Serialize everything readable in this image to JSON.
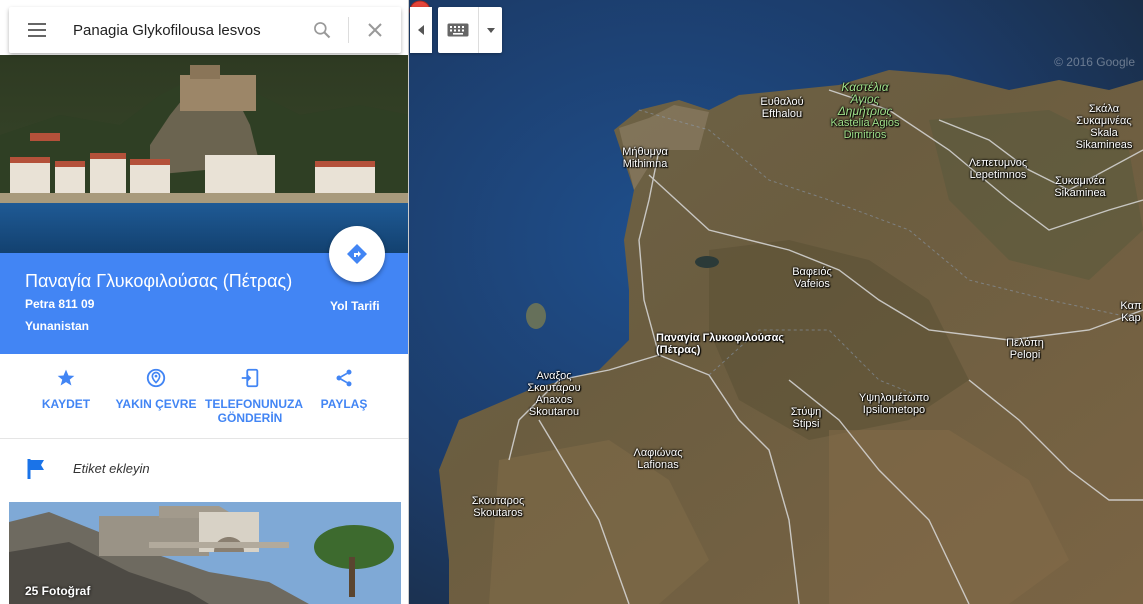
{
  "search": {
    "query": "Panagia Glykofilousa lesvos"
  },
  "place": {
    "title": "Παναγία Γλυκοφιλούσας (Πέτρας)",
    "address_line1": "Petra 811 09",
    "address_line2": "Yunanistan",
    "directions_label": "Yol Tarifi",
    "accent_color": "#4285f4"
  },
  "actions": [
    {
      "label": "KAYDET",
      "icon": "star-icon"
    },
    {
      "label": "YAKIN ÇEVRE",
      "icon": "nearby-icon"
    },
    {
      "label_line1": "TELEFONUNUZA",
      "label_line2": "GÖNDERİN",
      "icon": "send-to-phone-icon"
    },
    {
      "label": "PAYLAŞ",
      "icon": "share-icon"
    }
  ],
  "add_label": "Etiket ekleyin",
  "photos": {
    "count_label": "25 Fotoğraf"
  },
  "map": {
    "copyright": "© 2016 Google",
    "pin_label_line1": "Παναγία Γλυκοφιλούσας",
    "pin_label_line2": "(Πέτρας)",
    "places": {
      "efthalou": [
        "Ευθαλού",
        "Efthalou"
      ],
      "kastelia": [
        "Καστέλια",
        "Άγιος",
        "Δημήτριος",
        "Kastelia Agios",
        "Dimitrios"
      ],
      "mithymna": [
        "Μήθυμνα",
        "Mithimna"
      ],
      "lepetymnos": [
        "Λεπετυμνος",
        "Lepetimnos"
      ],
      "skala": [
        "Σκάλα",
        "Συκαμινέας",
        "Skala",
        "Sikamineas"
      ],
      "sykaminea": [
        "Συκαμινέα",
        "Sikaminea"
      ],
      "vafeios": [
        "Βαφειός",
        "Vafeios"
      ],
      "anaxos": [
        "Αναξος",
        "Σκουτάρου",
        "Anaxos",
        "Skoutarou"
      ],
      "stipsi": [
        "Στύψη",
        "Stipsi"
      ],
      "ipsilometopo": [
        "Υψηλομέτωπο",
        "Ipsilometopo"
      ],
      "pelopi": [
        "Πελόπη",
        "Pelopi"
      ],
      "lafionas": [
        "Λαφιώνας",
        "Lafionas"
      ],
      "skoutaros": [
        "Σκουταρος",
        "Skoutaros"
      ],
      "edge": [
        "Καπ",
        "Kap"
      ]
    }
  }
}
